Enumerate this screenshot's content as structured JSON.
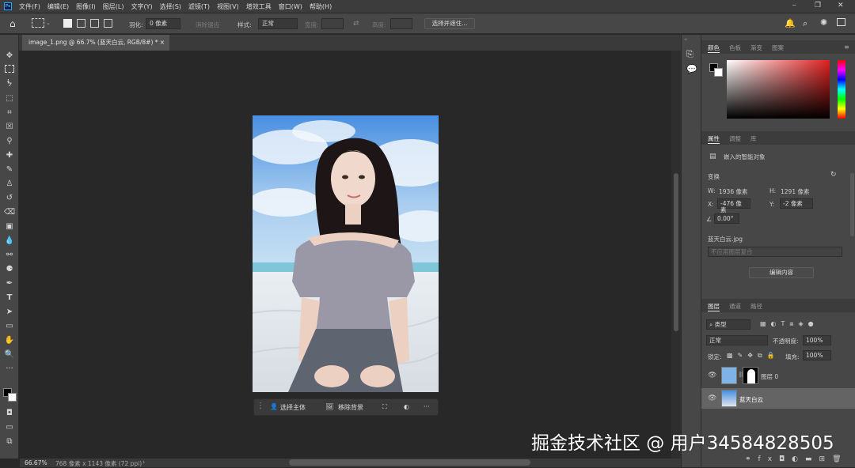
{
  "app_logo": "Ps",
  "menu": [
    "文件(F)",
    "编辑(E)",
    "图像(I)",
    "图层(L)",
    "文字(Y)",
    "选择(S)",
    "滤镜(T)",
    "视图(V)",
    "增效工具",
    "窗口(W)",
    "帮助(H)"
  ],
  "options": {
    "feather_label": "羽化:",
    "feather_value": "0 像素",
    "antialias_label": "消除锯齿",
    "style_label": "样式:",
    "style_value": "正常",
    "width_label": "宽度:",
    "height_label": "高度:",
    "select_mask_button": "选择并遮住..."
  },
  "document_tab": {
    "title": "image_1.png @ 66.7% (蓝天白云, RGB/8#) *",
    "close": "×"
  },
  "contextual_bar": {
    "select_subject": "选择主体",
    "remove_background": "移除背景",
    "more": "···"
  },
  "status": {
    "zoom": "66.67%",
    "doc_info": "768 像素 x 1143 像素 (72 ppi)",
    "arrow": "›"
  },
  "color_panel": {
    "tabs": [
      "颜色",
      "色板",
      "渐变",
      "图案"
    ],
    "active_tab": "颜色",
    "foreground": "#000000",
    "background": "#ffffff",
    "picker_hue": "#e02020"
  },
  "properties_panel": {
    "tabs": [
      "属性",
      "调整",
      "库"
    ],
    "active_tab": "属性",
    "object_type": "嵌入的智能对象",
    "transform_label": "变换",
    "w_label": "W:",
    "w_value": "1936 像素",
    "h_label": "H:",
    "h_value": "1291 像素",
    "x_label": "X:",
    "x_value": "-476 像素",
    "y_label": "Y:",
    "y_value": "-2 像素",
    "angle_value": "0.00°",
    "filename": "蓝天白云.jpg",
    "layer_comp_placeholder": "不应用图层复合",
    "edit_contents_button": "编辑内容"
  },
  "layers_panel": {
    "tabs": [
      "图层",
      "通道",
      "路径"
    ],
    "active_tab": "图层",
    "filter_label": "类型",
    "blend_mode": "正常",
    "opacity_label": "不透明度:",
    "opacity_value": "100%",
    "lock_label": "锁定:",
    "fill_label": "填充:",
    "fill_value": "100%",
    "layers": [
      {
        "name": "图层 0",
        "visible": true,
        "selected": false
      },
      {
        "name": "蓝天白云",
        "visible": true,
        "selected": true
      }
    ],
    "footer_icons": [
      "link-icon",
      "fx-icon",
      "mask-icon",
      "adjustment-icon",
      "group-icon",
      "new-layer-icon",
      "trash-icon"
    ]
  },
  "watermark": "掘金技术社区 @ 用户34584828505"
}
